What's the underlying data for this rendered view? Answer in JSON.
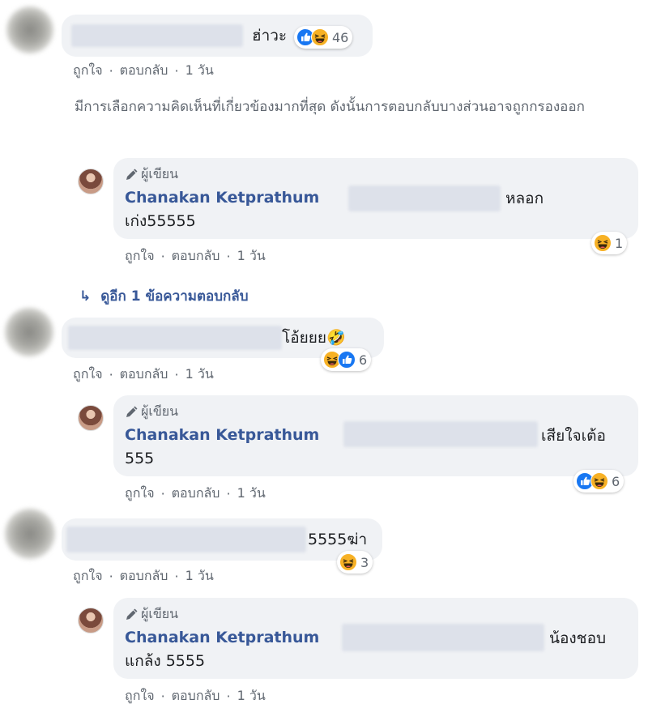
{
  "actions": {
    "like": "ถูกใจ",
    "reply": "ตอบกลับ",
    "sep": "·"
  },
  "author": {
    "badge": "ผู้เขียน",
    "name": "Chanakan Ketprathum"
  },
  "filter_note": "มีการเลือกความคิดเห็นที่เกี่ยวข้องมากที่สุด ดังนั้นการตอบกลับบางส่วนอาจถูกกรองออก",
  "more_replies": "ดูอีก 1 ข้อความตอบกลับ",
  "comments": [
    {
      "text": "ฮ่าวะ",
      "time": "1 วัน",
      "reaction_count": "46",
      "reactions": [
        "like-icon",
        "haha-icon"
      ],
      "reply": {
        "line1_end": "หลอก",
        "line2": "เก่ง55555",
        "time": "1 วัน",
        "reaction_count": "1",
        "reactions": [
          "haha-icon"
        ]
      }
    },
    {
      "text": "โอ้ยยย🤣",
      "time": "1 วัน",
      "reaction_count": "6",
      "reactions": [
        "haha-icon",
        "like-icon"
      ],
      "reply": {
        "line1_end": "เสียใจเต้อ",
        "line2": "555",
        "time": "1 วัน",
        "reaction_count": "6",
        "reactions": [
          "like-icon",
          "haha-icon"
        ]
      }
    },
    {
      "text": "5555ฆ่า",
      "time": "1 วัน",
      "reaction_count": "3",
      "reactions": [
        "haha-icon"
      ],
      "reply": {
        "line1_end": "น้องชอบ",
        "line2": "แกล้ง 5555",
        "time": "1 วัน"
      }
    }
  ],
  "colors": {
    "bubble": "#f0f2f5",
    "link_blue": "#385898",
    "meta_grey": "#606770",
    "like_blue": "#1877f2",
    "haha_yellow": "#f7b125"
  }
}
